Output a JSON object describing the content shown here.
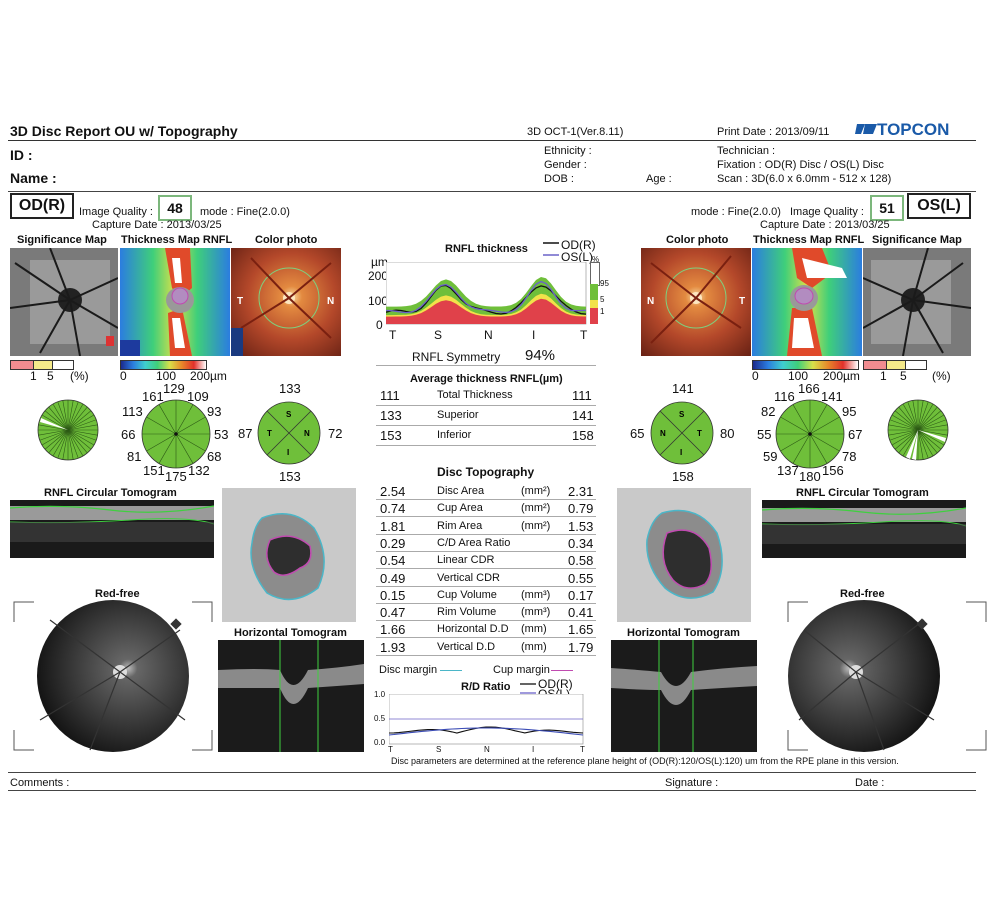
{
  "header": {
    "title": "3D Disc Report OU w/ Topography",
    "device": "3D OCT-1(Ver.8.11)",
    "print_date": "Print Date : 2013/09/11",
    "brand": "TOPCON",
    "id_label": "ID :",
    "name_label": "Name :",
    "ethnicity": "Ethnicity :",
    "gender": "Gender :",
    "dob": "DOB :",
    "age": "Age :",
    "technician": "Technician :",
    "fixation": "Fixation : OD(R) Disc / OS(L) Disc",
    "scan": "Scan : 3D(6.0 x 6.0mm - 512 x 128)"
  },
  "od": {
    "eye": "OD(R)",
    "iq_label": "Image Quality :",
    "iq": "48",
    "mode": "mode : Fine(2.0.0)",
    "capture": "Capture Date : 2013/03/25",
    "sig_title": "Significance Map",
    "thick_title": "Thickness Map RNFL",
    "color_title": "Color photo",
    "sig_legend": [
      "1",
      "5",
      "(%)"
    ],
    "thick_legend": [
      "0",
      "100",
      "200µm"
    ],
    "clock": {
      "top": "129",
      "tl": "161",
      "tr": "109",
      "ul": "113",
      "ur": "93",
      "l": "66",
      "r": "53",
      "ll": "81",
      "lr": "68",
      "bl": "151",
      "b": "175",
      "br": "132"
    },
    "quad": {
      "S": "S",
      "T": "T",
      "N": "N",
      "I": "I",
      "top": "133",
      "left": "87",
      "right": "72",
      "bottom": "153"
    },
    "circ_title": "RNFL Circular Tomogram",
    "redfree_title": "Red-free",
    "horiz_title": "Horizontal Tomogram"
  },
  "os": {
    "eye": "OS(L)",
    "iq_label": "Image Quality :",
    "iq": "51",
    "mode": "mode : Fine(2.0.0)",
    "capture": "Capture Date : 2013/03/25",
    "sig_title": "Significance Map",
    "thick_title": "Thickness Map RNFL",
    "color_title": "Color photo",
    "sig_legend": [
      "1",
      "5",
      "(%)"
    ],
    "thick_legend": [
      "0",
      "100",
      "200µm"
    ],
    "clock": {
      "top": "166",
      "tl": "116",
      "tr": "141",
      "ul": "82",
      "ur": "95",
      "l": "55",
      "r": "67",
      "ll": "59",
      "lr": "78",
      "bl": "137",
      "b": "180",
      "br": "156"
    },
    "quad": {
      "S": "S",
      "T": "T",
      "N": "N",
      "I": "I",
      "top": "141",
      "left": "65",
      "right": "80",
      "bottom": "158"
    },
    "circ_title": "RNFL Circular Tomogram",
    "redfree_title": "Red-free",
    "horiz_title": "Horizontal Tomogram"
  },
  "center": {
    "rnfl_title": "RNFL thickness",
    "legend_od": "OD(R)",
    "legend_os": "OS(L)",
    "yunit": "µm",
    "yticks": [
      "200",
      "100",
      "0"
    ],
    "xticks": [
      "T",
      "S",
      "N",
      "I",
      "T"
    ],
    "pct": [
      "%",
      "95",
      "5",
      "1"
    ],
    "symmetry_label": "RNFL Symmetry",
    "symmetry_value": "94%",
    "avg_title": "Average thickness RNFL(µm)",
    "avg_rows": [
      {
        "od": "111",
        "label": "Total Thickness",
        "os": "111"
      },
      {
        "od": "133",
        "label": "Superior",
        "os": "141"
      },
      {
        "od": "153",
        "label": "Inferior",
        "os": "158"
      }
    ],
    "topo_title": "Disc Topography",
    "topo_rows": [
      {
        "od": "2.54",
        "label": "Disc Area",
        "unit": "(mm²)",
        "os": "2.31"
      },
      {
        "od": "0.74",
        "label": "Cup Area",
        "unit": "(mm²)",
        "os": "0.79"
      },
      {
        "od": "1.81",
        "label": "Rim Area",
        "unit": "(mm²)",
        "os": "1.53"
      },
      {
        "od": "0.29",
        "label": "C/D Area Ratio",
        "unit": "",
        "os": "0.34"
      },
      {
        "od": "0.54",
        "label": "Linear CDR",
        "unit": "",
        "os": "0.58"
      },
      {
        "od": "0.49",
        "label": "Vertical CDR",
        "unit": "",
        "os": "0.55"
      },
      {
        "od": "0.15",
        "label": "Cup Volume",
        "unit": "(mm³)",
        "os": "0.17"
      },
      {
        "od": "0.47",
        "label": "Rim Volume",
        "unit": "(mm³)",
        "os": "0.41"
      },
      {
        "od": "1.66",
        "label": "Horizontal D.D",
        "unit": "(mm)",
        "os": "1.65"
      },
      {
        "od": "1.93",
        "label": "Vertical D.D",
        "unit": "(mm)",
        "os": "1.79"
      }
    ],
    "disc_margin": "Disc margin",
    "cup_margin": "Cup margin",
    "rd_title": "R/D Ratio",
    "rd_yticks": [
      "1.0",
      "0.5",
      "0.0"
    ],
    "rd_xticks": [
      "T",
      "S",
      "N",
      "I",
      "T"
    ],
    "rd_legend_od": "OD(R)",
    "rd_legend_os": "OS(L)",
    "footnote": "Disc parameters are determined at the reference plane height of (OD(R):120/OS(L):120) um from the RPE plane in this version."
  },
  "footer": {
    "comments": "Comments :",
    "signature": "Signature :",
    "date": "Date :"
  },
  "colors": {
    "green": "#6fbf3a",
    "red": "#e0414a",
    "yellow": "#f2e24a",
    "od_line": "#111111",
    "os_line": "#6b62c9",
    "disc": "#4bb6c8",
    "cup": "#c04bb0"
  }
}
